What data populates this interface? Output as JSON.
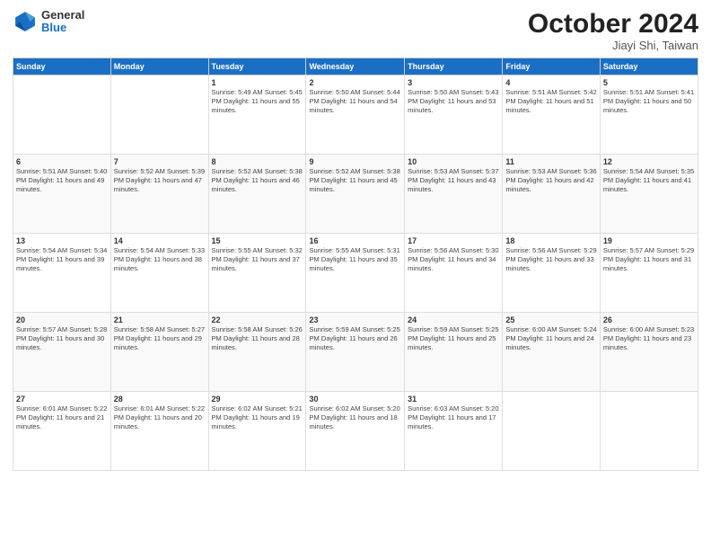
{
  "header": {
    "logo_general": "General",
    "logo_blue": "Blue",
    "month_title": "October 2024",
    "location": "Jiayi Shi, Taiwan"
  },
  "weekdays": [
    "Sunday",
    "Monday",
    "Tuesday",
    "Wednesday",
    "Thursday",
    "Friday",
    "Saturday"
  ],
  "weeks": [
    [
      {
        "day": "",
        "info": ""
      },
      {
        "day": "",
        "info": ""
      },
      {
        "day": "1",
        "info": "Sunrise: 5:49 AM\nSunset: 5:45 PM\nDaylight: 11 hours\nand 55 minutes."
      },
      {
        "day": "2",
        "info": "Sunrise: 5:50 AM\nSunset: 5:44 PM\nDaylight: 11 hours\nand 54 minutes."
      },
      {
        "day": "3",
        "info": "Sunrise: 5:50 AM\nSunset: 5:43 PM\nDaylight: 11 hours\nand 53 minutes."
      },
      {
        "day": "4",
        "info": "Sunrise: 5:51 AM\nSunset: 5:42 PM\nDaylight: 11 hours\nand 51 minutes."
      },
      {
        "day": "5",
        "info": "Sunrise: 5:51 AM\nSunset: 5:41 PM\nDaylight: 11 hours\nand 50 minutes."
      }
    ],
    [
      {
        "day": "6",
        "info": "Sunrise: 5:51 AM\nSunset: 5:40 PM\nDaylight: 11 hours\nand 49 minutes."
      },
      {
        "day": "7",
        "info": "Sunrise: 5:52 AM\nSunset: 5:39 PM\nDaylight: 11 hours\nand 47 minutes."
      },
      {
        "day": "8",
        "info": "Sunrise: 5:52 AM\nSunset: 5:38 PM\nDaylight: 11 hours\nand 46 minutes."
      },
      {
        "day": "9",
        "info": "Sunrise: 5:52 AM\nSunset: 5:38 PM\nDaylight: 11 hours\nand 45 minutes."
      },
      {
        "day": "10",
        "info": "Sunrise: 5:53 AM\nSunset: 5:37 PM\nDaylight: 11 hours\nand 43 minutes."
      },
      {
        "day": "11",
        "info": "Sunrise: 5:53 AM\nSunset: 5:36 PM\nDaylight: 11 hours\nand 42 minutes."
      },
      {
        "day": "12",
        "info": "Sunrise: 5:54 AM\nSunset: 5:35 PM\nDaylight: 11 hours\nand 41 minutes."
      }
    ],
    [
      {
        "day": "13",
        "info": "Sunrise: 5:54 AM\nSunset: 5:34 PM\nDaylight: 11 hours\nand 39 minutes."
      },
      {
        "day": "14",
        "info": "Sunrise: 5:54 AM\nSunset: 5:33 PM\nDaylight: 11 hours\nand 38 minutes."
      },
      {
        "day": "15",
        "info": "Sunrise: 5:55 AM\nSunset: 5:32 PM\nDaylight: 11 hours\nand 37 minutes."
      },
      {
        "day": "16",
        "info": "Sunrise: 5:55 AM\nSunset: 5:31 PM\nDaylight: 11 hours\nand 35 minutes."
      },
      {
        "day": "17",
        "info": "Sunrise: 5:56 AM\nSunset: 5:30 PM\nDaylight: 11 hours\nand 34 minutes."
      },
      {
        "day": "18",
        "info": "Sunrise: 5:56 AM\nSunset: 5:29 PM\nDaylight: 11 hours\nand 33 minutes."
      },
      {
        "day": "19",
        "info": "Sunrise: 5:57 AM\nSunset: 5:29 PM\nDaylight: 11 hours\nand 31 minutes."
      }
    ],
    [
      {
        "day": "20",
        "info": "Sunrise: 5:57 AM\nSunset: 5:28 PM\nDaylight: 11 hours\nand 30 minutes."
      },
      {
        "day": "21",
        "info": "Sunrise: 5:58 AM\nSunset: 5:27 PM\nDaylight: 11 hours\nand 29 minutes."
      },
      {
        "day": "22",
        "info": "Sunrise: 5:58 AM\nSunset: 5:26 PM\nDaylight: 11 hours\nand 28 minutes."
      },
      {
        "day": "23",
        "info": "Sunrise: 5:59 AM\nSunset: 5:25 PM\nDaylight: 11 hours\nand 26 minutes."
      },
      {
        "day": "24",
        "info": "Sunrise: 5:59 AM\nSunset: 5:25 PM\nDaylight: 11 hours\nand 25 minutes."
      },
      {
        "day": "25",
        "info": "Sunrise: 6:00 AM\nSunset: 5:24 PM\nDaylight: 11 hours\nand 24 minutes."
      },
      {
        "day": "26",
        "info": "Sunrise: 6:00 AM\nSunset: 5:23 PM\nDaylight: 11 hours\nand 23 minutes."
      }
    ],
    [
      {
        "day": "27",
        "info": "Sunrise: 6:01 AM\nSunset: 5:22 PM\nDaylight: 11 hours\nand 21 minutes."
      },
      {
        "day": "28",
        "info": "Sunrise: 6:01 AM\nSunset: 5:22 PM\nDaylight: 11 hours\nand 20 minutes."
      },
      {
        "day": "29",
        "info": "Sunrise: 6:02 AM\nSunset: 5:21 PM\nDaylight: 11 hours\nand 19 minutes."
      },
      {
        "day": "30",
        "info": "Sunrise: 6:02 AM\nSunset: 5:20 PM\nDaylight: 11 hours\nand 18 minutes."
      },
      {
        "day": "31",
        "info": "Sunrise: 6:03 AM\nSunset: 5:20 PM\nDaylight: 11 hours\nand 17 minutes."
      },
      {
        "day": "",
        "info": ""
      },
      {
        "day": "",
        "info": ""
      }
    ]
  ]
}
